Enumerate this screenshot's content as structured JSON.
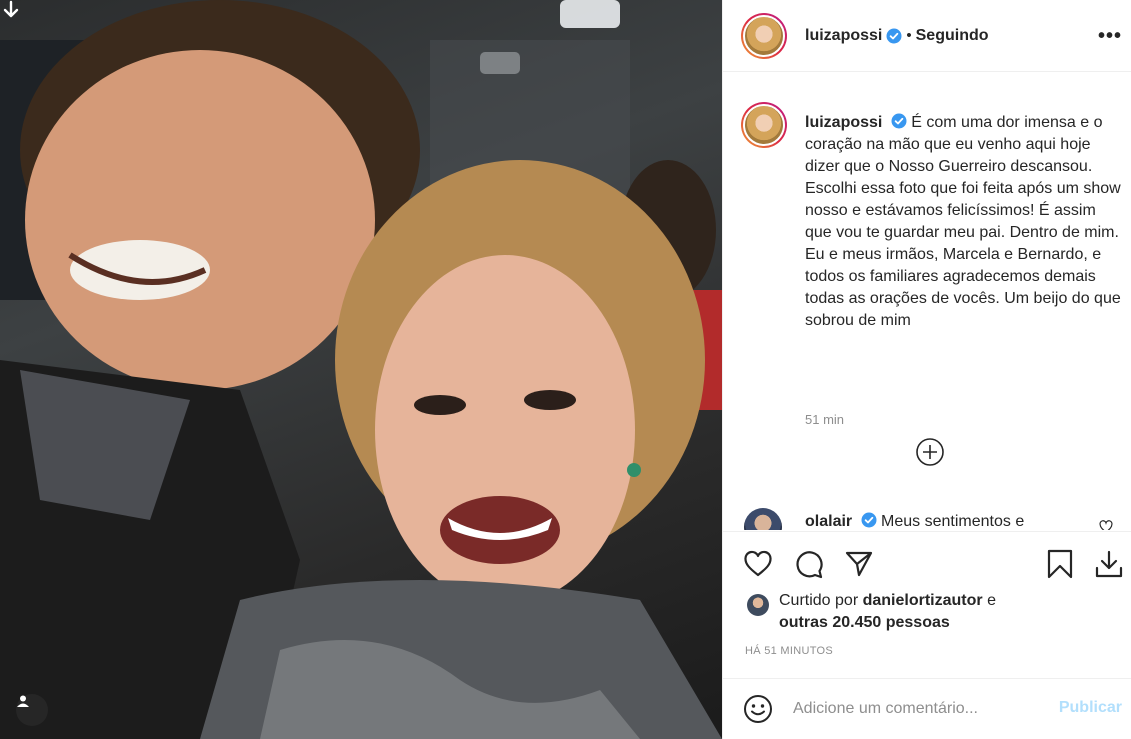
{
  "post": {
    "username": "luizapossi",
    "follow_status": "Seguindo",
    "more_label": "•••"
  },
  "caption": {
    "username": "luizapossi",
    "text": "É com uma dor imensa e o coração na mão que eu venho aqui hoje dizer que o Nosso Guerreiro descansou. Escolhi essa foto que foi feita após um show nosso e estávamos felicíssimos! É assim que vou te guardar meu pai. Dentro de mim. Eu e meus irmãos, Marcela e Bernardo, e todos os familiares agradecemos demais todas as orações de vocês. Um beijo do que sobrou de mim",
    "time": "51 min"
  },
  "comment": {
    "username": "olalair",
    "text": "Meus sentimentos e"
  },
  "likes": {
    "prefix": "Curtido por",
    "user": "danielortizautor",
    "conjunction": "e",
    "others": "outras 20.450 pessoas"
  },
  "post_time": "HÁ 51 MINUTOS",
  "composer": {
    "placeholder": "Adicione um comentário...",
    "submit_label": "Publicar"
  },
  "colors": {
    "verified_blue": "#3897f0",
    "publish_disabled": "#b2dffc",
    "muted_gray": "#8e8e8e"
  },
  "icons": [
    "download-icon",
    "user-tag-icon",
    "verified-icon",
    "more-icon",
    "plus-circle-icon",
    "heart-icon",
    "comment-icon",
    "share-icon",
    "bookmark-icon",
    "save-download-icon",
    "emoji-icon"
  ]
}
